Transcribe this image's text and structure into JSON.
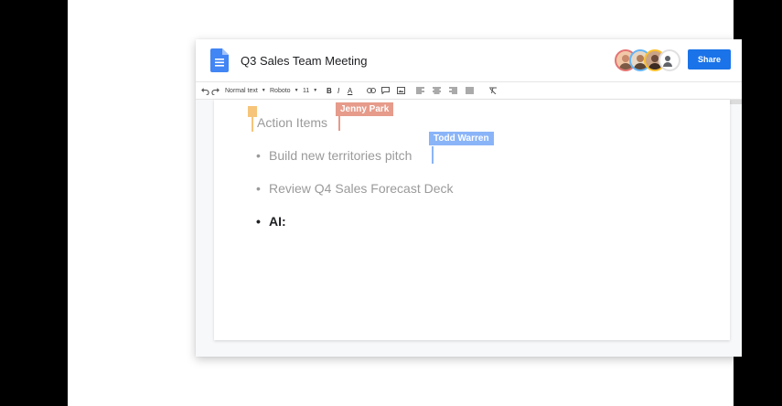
{
  "document": {
    "title": "Q3 Sales Team Meeting",
    "heading": "Action Items",
    "bullets": [
      "Build new territories pitch",
      "Review Q4 Sales Forecast Deck",
      "AI:"
    ]
  },
  "header": {
    "share_label": "Share"
  },
  "toolbar": {
    "style_select": "Normal text",
    "font_select": "Roboto",
    "size_select": "11",
    "bold": "B",
    "italic": "I",
    "underline": "A"
  },
  "collaborators": [
    {
      "name": "Jenny Park",
      "color": "#e69b8b"
    },
    {
      "name": "Todd Warren",
      "color": "#8ab4f8"
    }
  ],
  "own_cursor_color": "#f6c57a",
  "colors": {
    "accent": "#1a73e8",
    "doc_icon": "#4285f4"
  }
}
